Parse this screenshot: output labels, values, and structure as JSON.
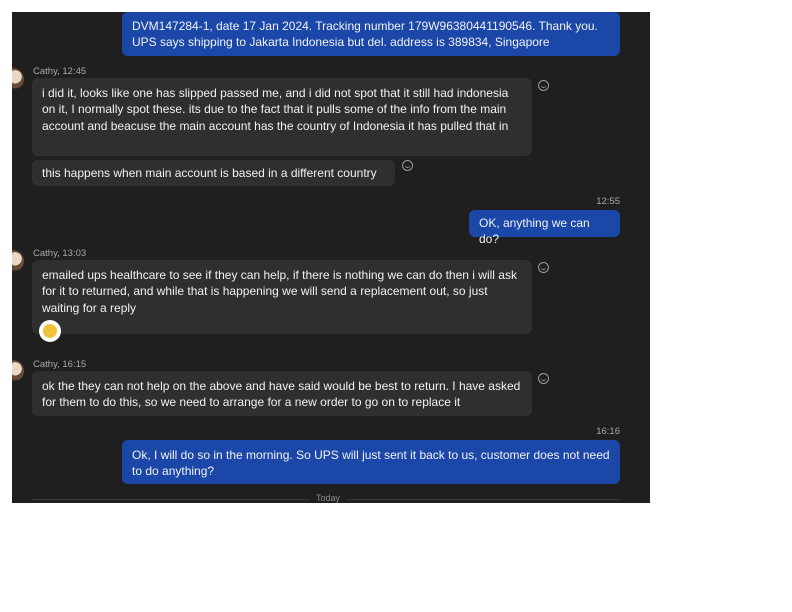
{
  "messages": [
    {
      "text": "DVM147284-1, date 17 Jan 2024.  Tracking number 179W96380441190546.  Thank you.  UPS says shipping to Jakarta Indonesia but del. address is 389834, Singapore"
    },
    {
      "sender": "Cathy, 12:45",
      "text": "i did it, looks like one has slipped passed me, and i did not spot that it still had indonesia on it, I normally spot these.  its due to the fact that it pulls some of the info from the main account and beacuse the main account has the country of Indonesia it has pulled that in"
    },
    {
      "text": "this happens when  main account is based in a different country"
    },
    {
      "time": "12:55",
      "text": "OK, anything we can do?"
    },
    {
      "sender": "Cathy, 13:03",
      "text": "emailed ups healthcare to see if they can help, if there is nothing we can do then i will ask for it to returned, and while that is happening we will send a replacement out, so just waiting for a reply"
    },
    {
      "sender": "Cathy, 16:15",
      "text": "ok the they can not help on the above and have said would be best to return.  I have asked for them to do this, so we need to arrange for a new order to go on  to replace it"
    },
    {
      "time": "16:16",
      "text": "Ok, I will do so in the morning.  So UPS will just sent it back to us, customer does not need to do anything?"
    }
  ],
  "divider": {
    "label": "Today"
  }
}
